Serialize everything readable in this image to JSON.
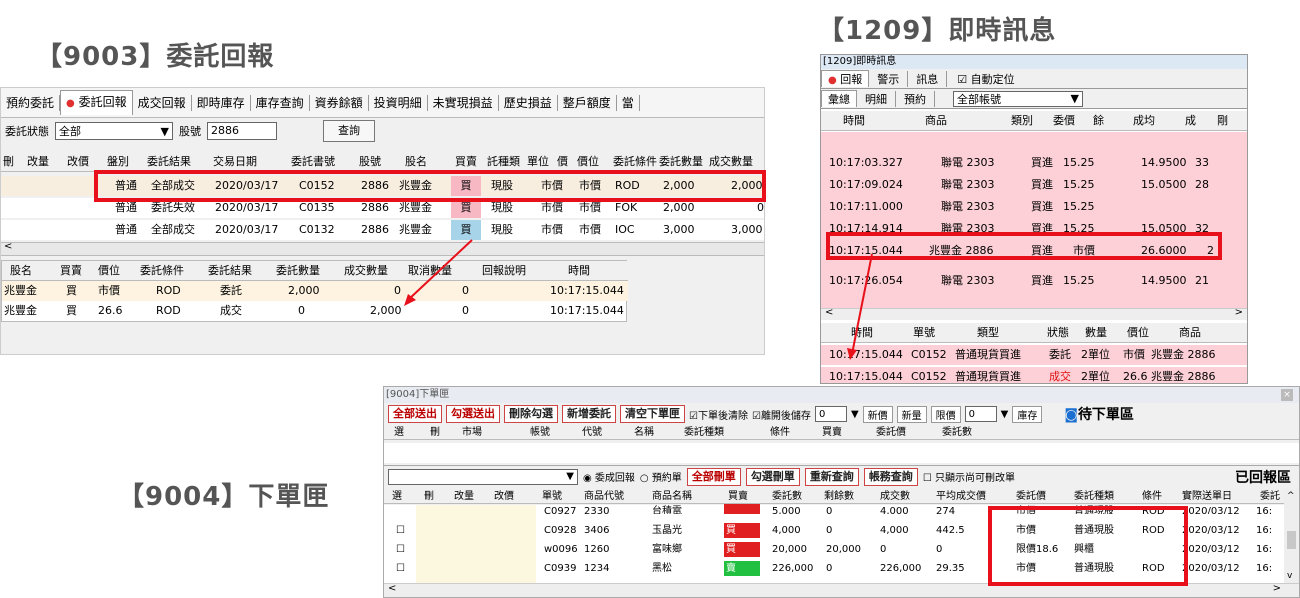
{
  "titles": {
    "t9003": "【9003】委託回報",
    "t1209": "【1209】即時訊息",
    "t9004": "【9004】下單匣"
  },
  "p9003": {
    "tabs": [
      "預約委託",
      "委託回報",
      "成交回報",
      "即時庫存",
      "庫存查詢",
      "資券餘額",
      "投資明細",
      "未實現損益",
      "歷史損益",
      "整戶額度",
      "當"
    ],
    "status_label": "委託狀態",
    "status_value": "全部",
    "stock_label": "股號",
    "stock_value": "2886",
    "query_label": "查詢",
    "headers": [
      "刪",
      "改量",
      "改價",
      "盤別",
      "委託結果",
      "交易日期",
      "委託書號",
      "股號",
      "股名",
      "買賣",
      "託種類",
      "單位",
      "價",
      "價位",
      "委託條件",
      "委託數量",
      "成交數量"
    ],
    "rows": [
      [
        "普通",
        "全部成交",
        "2020/03/17",
        "C0152",
        "2886",
        "兆豐金",
        "買",
        "現股",
        "市價",
        "市價",
        "ROD",
        "2,000",
        "2,000"
      ],
      [
        "普通",
        "委託失效",
        "2020/03/17",
        "C0135",
        "2886",
        "兆豐金",
        "買",
        "現股",
        "市價",
        "市價",
        "FOK",
        "2,000",
        "0"
      ],
      [
        "普通",
        "全部成交",
        "2020/03/17",
        "C0132",
        "2886",
        "兆豐金",
        "買",
        "現股",
        "市價",
        "市價",
        "IOC",
        "3,000",
        "3,000"
      ]
    ],
    "sub_headers": [
      "股名",
      "買賣",
      "價位",
      "委託條件",
      "委託結果",
      "委託數量",
      "成交數量",
      "取消數量",
      "回報說明",
      "時間"
    ],
    "sub_rows": [
      [
        "兆豐金",
        "買",
        "市價",
        "ROD",
        "委託",
        "2,000",
        "0",
        "0",
        "",
        "10:17:15.044"
      ],
      [
        "兆豐金",
        "買",
        "26.6",
        "ROD",
        "成交",
        "0",
        "2,000",
        "0",
        "",
        "10:17:15.044"
      ]
    ]
  },
  "p1209": {
    "window_title": "[1209]即時訊息",
    "tabs": [
      "回報",
      "警示",
      "訊息"
    ],
    "auto_label": "自動定位",
    "tabs2": [
      "彙總",
      "明細",
      "預約"
    ],
    "account": "全部帳號",
    "headers": [
      "時間",
      "商品",
      "類別",
      "委價",
      "餘",
      "成均",
      "成",
      "剛"
    ],
    "rows": [
      [
        "10:17:03.327",
        "聯電 2303",
        "買進",
        "15.25",
        "",
        "14.9500",
        "33"
      ],
      [
        "10:17:09.024",
        "聯電 2303",
        "買進",
        "15.25",
        "",
        "15.0500",
        "28"
      ],
      [
        "10:17:11.000",
        "聯電 2303",
        "買進",
        "15.25",
        "",
        "",
        ""
      ],
      [
        "10:17:14.914",
        "聯電 2303",
        "買進",
        "15.25",
        "",
        "15.0500",
        "32"
      ],
      [
        "10:17:15.044",
        "兆豐金 2886",
        "買進",
        "市價",
        "",
        "26.6000",
        "2"
      ],
      [
        "10:17:26.054",
        "聯電 2303",
        "買進",
        "15.25",
        "",
        "14.9500",
        "21"
      ]
    ],
    "sub_headers": [
      "時間",
      "單號",
      "類型",
      "狀態",
      "數量",
      "價位",
      "商品"
    ],
    "sub_rows": [
      [
        "10:17:15.044",
        "C0152",
        "普通現貨買進",
        "委託",
        "2單位",
        "市價",
        "兆豐金 2886"
      ],
      [
        "10:17:15.044",
        "C0152",
        "普通現貨買進",
        "成交",
        "2單位",
        "26.6",
        "兆豐金 2886"
      ]
    ]
  },
  "p9004": {
    "window_title": "[9004]下單匣",
    "buttons": [
      "全部送出",
      "勾選送出",
      "刪除勾選",
      "新增委託",
      "清空下單匣"
    ],
    "opts": [
      "下單後清除",
      "離開後儲存"
    ],
    "save_val": "0",
    "new_price": "新價",
    "new_qty": "新量",
    "limit_label": "限價",
    "limit_val": "0",
    "stock_btn": "庫存",
    "pending": "待下單區",
    "head1": [
      "選",
      "刪",
      "市場",
      "帳號",
      "代號",
      "名稱",
      "委託種類",
      "條件",
      "買賣",
      "委託價",
      "委託數"
    ],
    "radio1": "委成回報",
    "radio2": "預約單",
    "btns2": [
      "全部刪單",
      "勾選刪單",
      "重新查詢",
      "帳務查詢"
    ],
    "only_cancel": "只顯示尚可刪改單",
    "reported": "已回報區",
    "headers": [
      "選",
      "刪",
      "改量",
      "改價",
      "單號",
      "商品代號",
      "商品名稱",
      "買賣",
      "委託數",
      "剩餘數",
      "成交數",
      "平均成交價",
      "委託價",
      "委託種類",
      "條件",
      "實際送單日",
      "委託"
    ],
    "rows": [
      [
        "C0927",
        "2330",
        "台積電",
        "",
        "5,000",
        "0",
        "4,000",
        "274",
        "市價",
        "普通現股",
        "ROD",
        "2020/03/12",
        "16:"
      ],
      [
        "C0928",
        "3406",
        "玉晶光",
        "買",
        "4,000",
        "0",
        "4,000",
        "442.5",
        "市價",
        "普通現股",
        "ROD",
        "2020/03/12",
        "16:"
      ],
      [
        "w0096",
        "1260",
        "富味鄉",
        "買",
        "20,000",
        "20,000",
        "0",
        "0",
        "限價18.6",
        "興櫃",
        "",
        "2020/03/12",
        "16:"
      ],
      [
        "C0939",
        "1234",
        "黑松",
        "賣",
        "226,000",
        "0",
        "226,000",
        "29.35",
        "市價",
        "普通現股",
        "ROD",
        "2020/03/12",
        "16:"
      ]
    ]
  }
}
